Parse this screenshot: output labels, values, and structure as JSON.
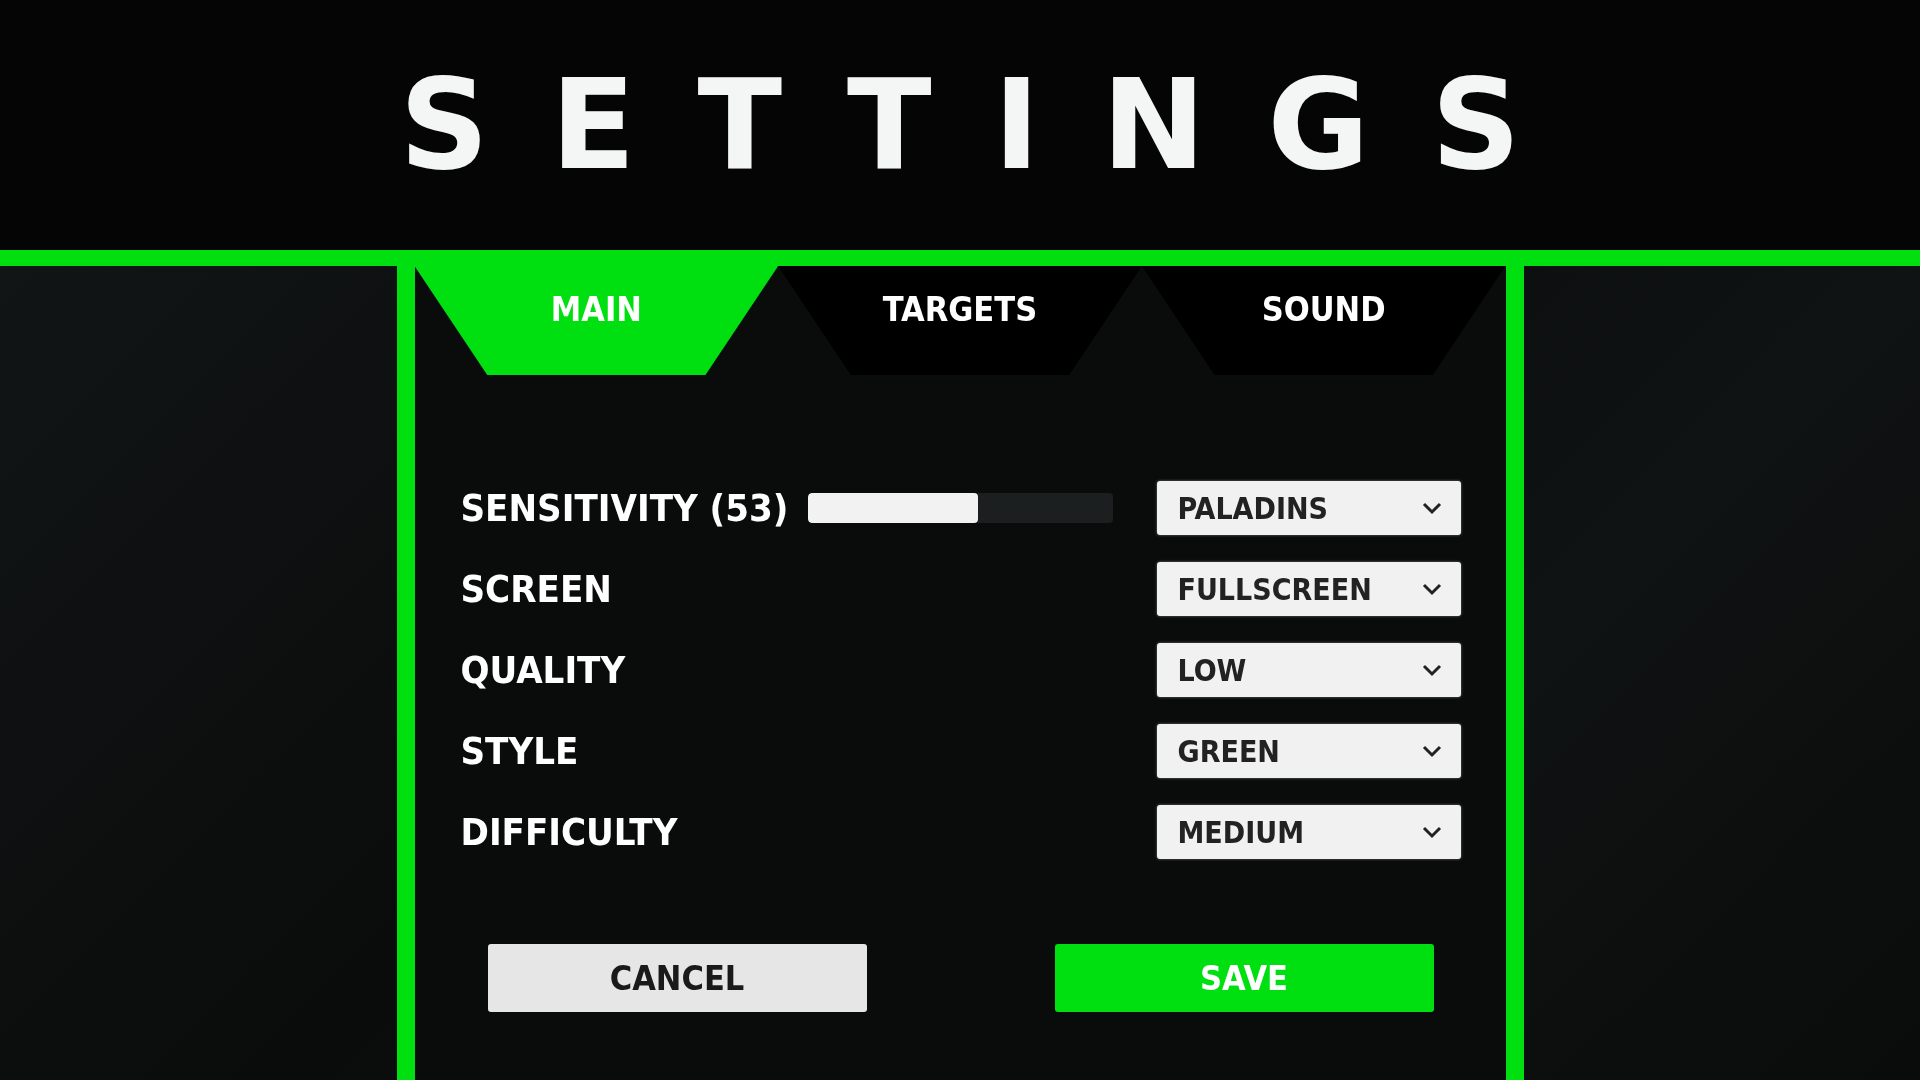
{
  "title": "SETTINGS",
  "tabs": [
    {
      "label": "MAIN",
      "selected": true
    },
    {
      "label": "TARGETS",
      "selected": false
    },
    {
      "label": "SOUND",
      "selected": false
    }
  ],
  "rows": [
    {
      "kind": "slider",
      "label": "SENSITIVITY (53)",
      "level": 0.56,
      "value": "PALADINS"
    },
    {
      "kind": "plain",
      "label": "SCREEN",
      "value": "FULLSCREEN"
    },
    {
      "kind": "plain",
      "label": "QUALITY",
      "value": "LOW"
    },
    {
      "kind": "plain",
      "label": "STYLE",
      "value": "GREEN"
    },
    {
      "kind": "plain",
      "label": "DIFFICULTY",
      "value": "MEDIUM"
    }
  ],
  "buttons": [
    {
      "kind": "cancel",
      "label": "CANCEL"
    },
    {
      "kind": "save",
      "label": "SAVE"
    }
  ]
}
